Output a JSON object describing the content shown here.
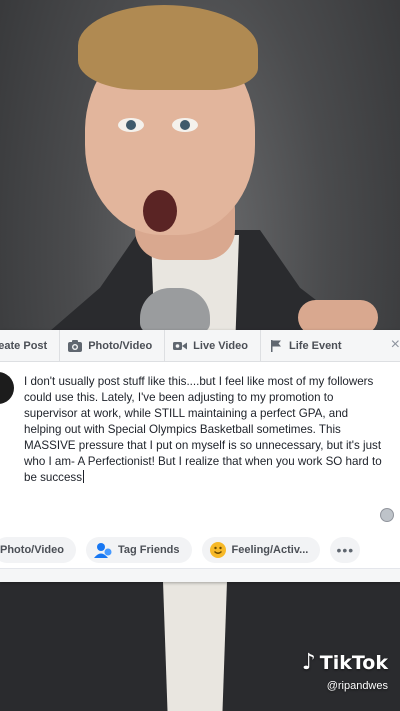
{
  "composer": {
    "tabs": [
      {
        "label": "reate Post",
        "icon": "pencil-icon"
      },
      {
        "label": "Photo/Video",
        "icon": "camera-icon"
      },
      {
        "label": "Live Video",
        "icon": "video-camera-icon"
      },
      {
        "label": "Life Event",
        "icon": "flag-icon"
      }
    ],
    "close_label": "×",
    "post_text": "I don't usually post stuff like this....but I feel like most of my followers could use this. Lately, I've been adjusting to my promotion to supervisor at work, while STILL maintaining a perfect GPA, and helping out with Special Olympics Basketball sometimes. This MASSIVE pressure that I put on myself is so unnecessary, but it's just who I am- A Perfectionist! But I realize that when you work SO hard to be success",
    "actions": [
      {
        "label": "Photo/Video",
        "icon": "photo-icon",
        "color": "#45bd62"
      },
      {
        "label": "Tag Friends",
        "icon": "tag-friends-icon",
        "color": "#1877f2"
      },
      {
        "label": "Feeling/Activ...",
        "icon": "smiley-icon",
        "color": "#f7b928"
      }
    ],
    "more_label": "•••"
  },
  "watermark": {
    "brand": "TikTok",
    "handle": "@ripandwes"
  },
  "colors": {
    "facebook_gray": "#4b4f56",
    "panel_bg": "#f5f6f7"
  }
}
